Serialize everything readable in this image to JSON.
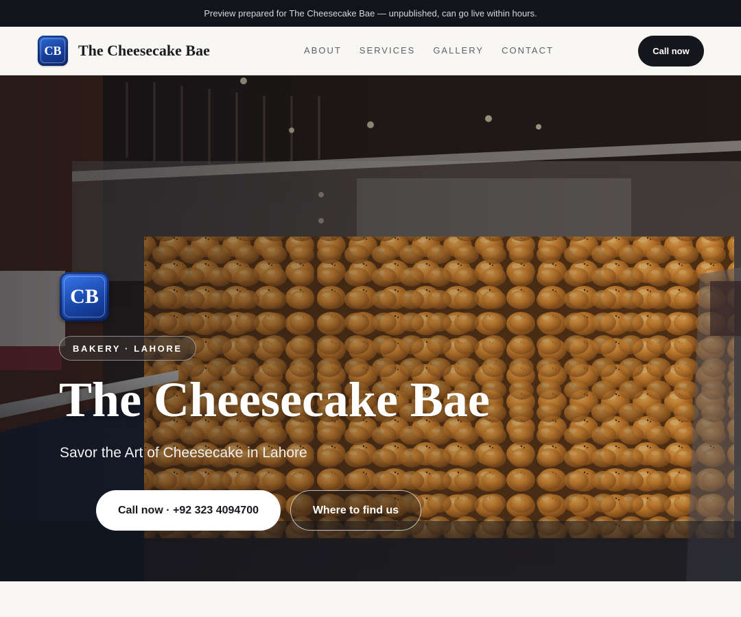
{
  "banner": {
    "text": "Preview prepared for The Cheesecake Bae — unpublished, can go live within hours."
  },
  "brand": {
    "logo_text": "CB",
    "name": "The Cheesecake Bae"
  },
  "nav": {
    "links": [
      "ABOUT",
      "SERVICES",
      "GALLERY",
      "CONTACT"
    ],
    "cta_label": "Call now"
  },
  "hero": {
    "logo_text": "CB",
    "tag": "BAKERY · LAHORE",
    "title": "The Cheesecake Bae",
    "subtitle": "Savor the Art of Cheesecake in Lahore",
    "primary_button": "Call now · +92 323 4094700",
    "secondary_button": "Where to find us"
  },
  "colors": {
    "topbar_bg": "#11141b",
    "page_bg": "#f8f7f3",
    "dark_button": "#15171c",
    "logo_blue": "#1a48ad"
  }
}
